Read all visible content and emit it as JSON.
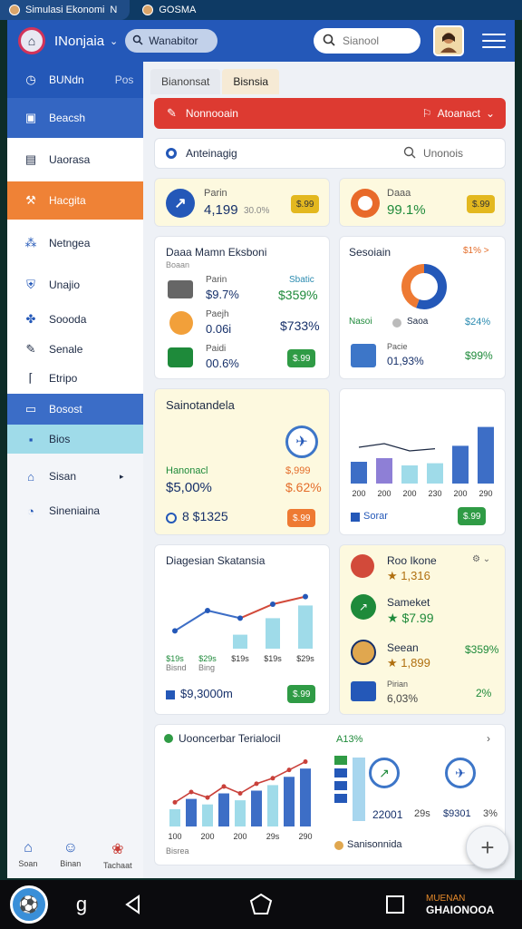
{
  "status_bar": {
    "tab1": "Simulasi Ekonomi",
    "tab1_close": "N",
    "tab2": "GOSMA"
  },
  "header": {
    "app_name": "INonjaia",
    "breadcrumb": "Wanabitor",
    "search_placeholder": "Sianool"
  },
  "sidebar": {
    "top_item": {
      "label": "BUNdn",
      "extra": "Pos"
    },
    "items": [
      {
        "label": "Beacsh",
        "icon": "monitor-icon"
      },
      {
        "label": "Uaorasa",
        "icon": "grid-icon"
      },
      {
        "label": "Hacgita",
        "icon": "tools-icon"
      },
      {
        "label": "Netngea",
        "icon": "network-icon"
      },
      {
        "label": "Unajio",
        "icon": "shield-icon"
      },
      {
        "label": "Soooda",
        "icon": "puzzle-icon"
      },
      {
        "label": "Senale",
        "icon": "pen-icon"
      },
      {
        "label": "Etripo",
        "icon": "bracket-icon"
      },
      {
        "label": "Bosost",
        "icon": "book-icon"
      },
      {
        "label": "Bios",
        "icon": "chip-icon"
      },
      {
        "label": "Sisan",
        "icon": "building-icon"
      },
      {
        "label": "Sineniaina",
        "icon": "clock-icon"
      }
    ]
  },
  "bottom_nav": [
    {
      "label": "Soan",
      "icon": "home-icon"
    },
    {
      "label": "Binan",
      "icon": "people-icon"
    },
    {
      "label": "Tachaat",
      "icon": "team-icon"
    }
  ],
  "tabs": [
    {
      "label": "Bianonsat"
    },
    {
      "label": "Bisnsia"
    }
  ],
  "alert": {
    "label": "Nonnooain",
    "action": "Atoanact"
  },
  "filter": {
    "label": "Anteinagig",
    "search": "Unonois"
  },
  "kpi1": {
    "label": "Parin",
    "value": "4,199",
    "pct": "30.0%",
    "badge": "$.99"
  },
  "kpi2": {
    "label": "Daaa",
    "value": "99.1%",
    "badge": "$.99"
  },
  "econ_card": {
    "title": "Daaa Mamn Eksboni",
    "subtitle": "Boaan",
    "rows": [
      {
        "label": "Parin",
        "value": "$9.7%",
        "right_label": "Sbatic",
        "right_value": "$359%"
      },
      {
        "label": "Paejh",
        "value": "0.06i",
        "right_value": "$733%"
      },
      {
        "label": "Paidi",
        "value": "00.6%",
        "badge": "$.99"
      }
    ]
  },
  "donut_card": {
    "title": "Sesoiain",
    "corner": "$1% >",
    "legend1": "Nasoi",
    "legend2": "Saoa",
    "legend2_value": "$24%",
    "item_label": "Pacie",
    "item_value": "01,93%",
    "item_right": "$99%"
  },
  "sim_card": {
    "title": "Sainotandela",
    "label": "Hanonacl",
    "value": "$5,00%",
    "right_label": "$,999",
    "right_value": "$.62%",
    "footer_value": "8 $1325",
    "badge": "$.99"
  },
  "bar_card": {
    "footer": "Sorar",
    "badge": "$.99",
    "xticks": [
      "200",
      "200",
      "200",
      "230",
      "200",
      "290"
    ]
  },
  "diag_card": {
    "title": "Diagesian Skatansia",
    "xticks": [
      "$19s",
      "$29s",
      "$19s",
      "$19s",
      "$29s"
    ],
    "sub1": "Bisnd",
    "sub2": "Bing",
    "footer_value": "$9,3000m",
    "badge": "$.99"
  },
  "list_card": {
    "title": "Roo Ikone",
    "items": [
      {
        "value": "★ 1,316"
      },
      {
        "label": "Sameket",
        "value": "★ $7.99"
      },
      {
        "label": "Seean",
        "value": "★ 1,899",
        "right": "$359%"
      }
    ],
    "footer_label": "Pirian",
    "footer_value": "6,03%",
    "footer_right": "2%"
  },
  "trend_card": {
    "title": "Uooncerbar Terialocil",
    "pct": "A13%",
    "xticks": [
      "100",
      "200",
      "200",
      "29s",
      "290"
    ],
    "sub": "Bisrea",
    "footer_label": "Sanisonnida",
    "val1": "22001",
    "val2": "29s",
    "val3": "$9301",
    "val4": "3%"
  },
  "chart_data": [
    {
      "type": "bar",
      "name": "bar_card",
      "categories": [
        "200",
        "200",
        "200",
        "230",
        "200",
        "290"
      ],
      "series": [
        {
          "values": [
            30,
            35,
            25,
            28,
            52,
            78
          ]
        }
      ],
      "ylim": [
        0,
        100
      ]
    },
    {
      "type": "line",
      "name": "diag_card",
      "categories": [
        "$19s",
        "$29s",
        "$19s",
        "$19s",
        "$29s"
      ],
      "series": [
        {
          "values": [
            28,
            60,
            48,
            70,
            82
          ]
        },
        {
          "values": [
            0,
            0,
            22,
            48,
            68
          ]
        }
      ],
      "ylim": [
        0,
        100
      ]
    },
    {
      "type": "bar",
      "name": "trend_card",
      "categories": [
        "100",
        "200",
        "200",
        "29s",
        "290"
      ],
      "series": [
        {
          "values": [
            25,
            40,
            32,
            48,
            38,
            52,
            60,
            72,
            84
          ]
        }
      ],
      "ylim": [
        0,
        100
      ]
    }
  ],
  "nav": {
    "brand_line1": "MUENAN",
    "brand_line2": "GHAIONOOA"
  },
  "colors": {
    "header_blue": "#2458b8",
    "alert_red": "#dd3a31",
    "green": "#2f9b45",
    "orange": "#ee7a33"
  }
}
